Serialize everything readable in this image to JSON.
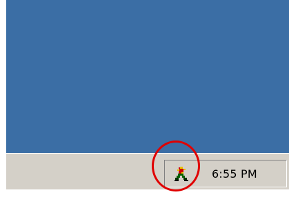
{
  "taskbar": {
    "tray": {
      "icon": "runner-figure-icon",
      "clock_label": "6:55 PM"
    }
  },
  "annotation": {
    "shape": "circle",
    "color": "#e00000",
    "target": "tray-icon"
  },
  "colors": {
    "desktop": "#3b6ea5",
    "taskbar": "#d4d0c8"
  }
}
